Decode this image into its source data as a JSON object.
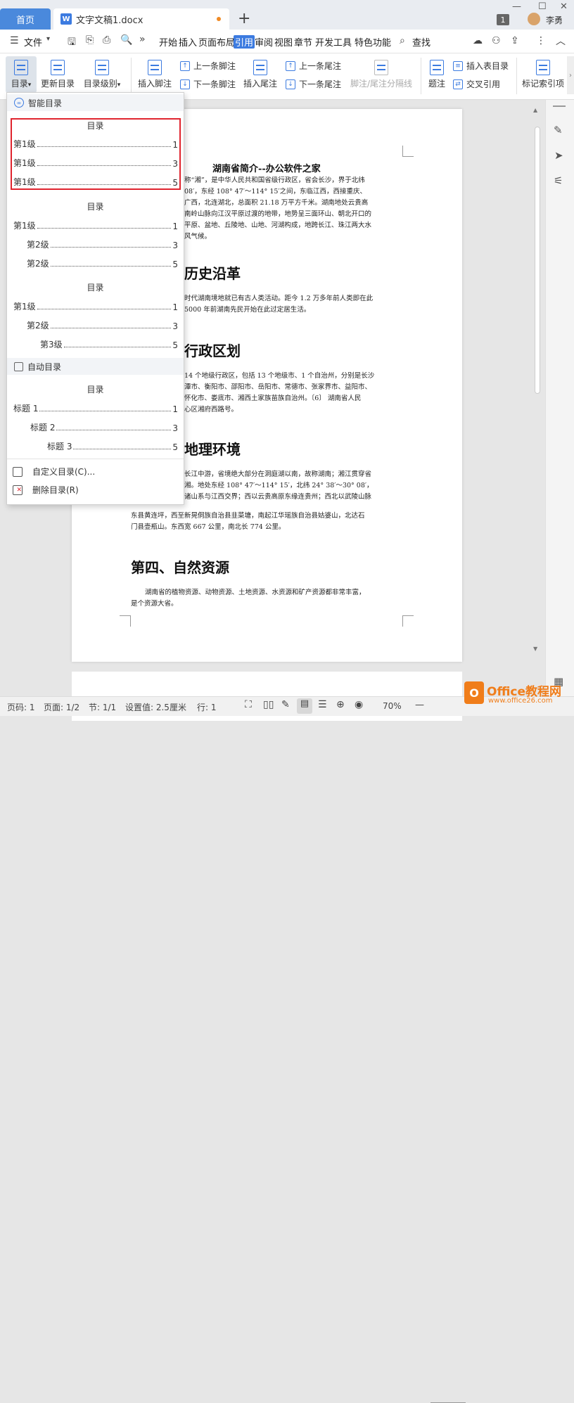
{
  "titlebar": {
    "home_tab": "首页",
    "doc_tab": "文字文稿1.docx",
    "doc_icon": "W",
    "page_badge": "1",
    "user_name": "李勇"
  },
  "menubar": {
    "file_label": "文件",
    "items": [
      "开始",
      "插入",
      "页面布局",
      "引用",
      "审阅",
      "视图",
      "章节",
      "开发工具",
      "特色功能"
    ],
    "active": "引用",
    "search_label": "查找"
  },
  "ribbon": {
    "toc": "目录",
    "update_toc": "更新目录",
    "toc_level": "目录级别",
    "insert_footnote": "插入脚注",
    "prev_footnote": "上一条脚注",
    "next_footnote": "下一条脚注",
    "insert_endnote": "插入尾注",
    "prev_endnote": "上一条尾注",
    "next_endnote": "下一条尾注",
    "separator_line": "脚注/尾注分隔线",
    "caption": "题注",
    "insert_table_of_figures": "插入表目录",
    "cross_reference": "交叉引用",
    "mark_index": "标记索引项"
  },
  "dropdown": {
    "smart_section": "智能目录",
    "auto_section": "自动目录",
    "toc_heading": "目录",
    "style1": [
      {
        "label": "第1级",
        "page": "1"
      },
      {
        "label": "第1级",
        "page": "3"
      },
      {
        "label": "第1级",
        "page": "5"
      }
    ],
    "style2": [
      {
        "label": "第1级",
        "page": "1"
      },
      {
        "label": "第2级",
        "page": "3"
      },
      {
        "label": "第2级",
        "page": "5"
      }
    ],
    "style3": [
      {
        "label": "第1级",
        "page": "1"
      },
      {
        "label": "第2级",
        "page": "3"
      },
      {
        "label": "第3级",
        "page": "5"
      }
    ],
    "auto": [
      {
        "label": "标题 1",
        "page": "1"
      },
      {
        "label": "标题 2",
        "page": "3"
      },
      {
        "label": "标题 3",
        "page": "5"
      }
    ],
    "custom_toc": "自定义目录(C)...",
    "delete_toc": "删除目录(R)"
  },
  "document": {
    "title": "湖南省简介--办公软件之家",
    "para1": [
      "称“湘”，是中华人民共和国省级行政区，省会长沙，界于北纬",
      "08′，东经 108° 47′～114° 15′之间，东临江西，西接重庆、",
      "广西，北连湖北，总面积 21.18 万平方千米。湖南地处云贵高",
      "南岭山脉向江汉平原过渡的地带，地势呈三面环山、朝北开口的",
      "平原、盆地、丘陵地、山地、河湖构成，地跨长江、珠江两大水",
      "风气候。"
    ],
    "h1": "历史沿革",
    "para2": [
      "时代湖南境地就已有古人类活动。距今 1.2 万多年前人类即在此",
      "5000 年前湖南先民开始在此过定居生活。"
    ],
    "h2": "行政区划",
    "para3": [
      "14 个地级行政区，包括 13 个地级市、1 个自治州，分别是长沙",
      "潭市、衡阳市、邵阳市、岳阳市、常德市、张家界市、益阳市、",
      "怀化市、娄底市、湘西土家族苗族自治州。〔6〕 湖南省人民",
      "心区湘府西路号。"
    ],
    "h3": "地理环境",
    "para4": [
      "长江中游，省境绝大部分在洞庭湖以南，故称湖南；湘江贯穿省",
      "湘。地处东经 108° 47′～114° 15′，北纬 24° 38′～30° 08′，",
      "诸山系与江西交界；西以云贵高原东缘连贵州；西北以武陵山脉"
    ],
    "para4_full": [
      "东县黄连坪，西至新晃侗族自治县韭菜塘，南起江华瑶族自治县姑婆山，北达石",
      "门县壶瓶山。东西宽 667 公里，南北长 774 公里。"
    ],
    "h4": "第四、自然资源",
    "para5": [
      "湖南省的植物资源、动物资源、土地资源、水资源和矿产资源都非常丰富，",
      "是个资源大省。"
    ]
  },
  "statusbar": {
    "page_no": "页码: 1",
    "page_of": "页面: 1/2",
    "section": "节: 1/1",
    "setting": "设置值: 2.5厘米",
    "row": "行: 1",
    "zoom": "70%"
  },
  "watermark": {
    "brand": "Office教程网",
    "url": "www.office26.com"
  },
  "colors": {
    "accent": "#3c7be0",
    "highlight": "#e0242e",
    "watermark": "#f07d1a"
  }
}
